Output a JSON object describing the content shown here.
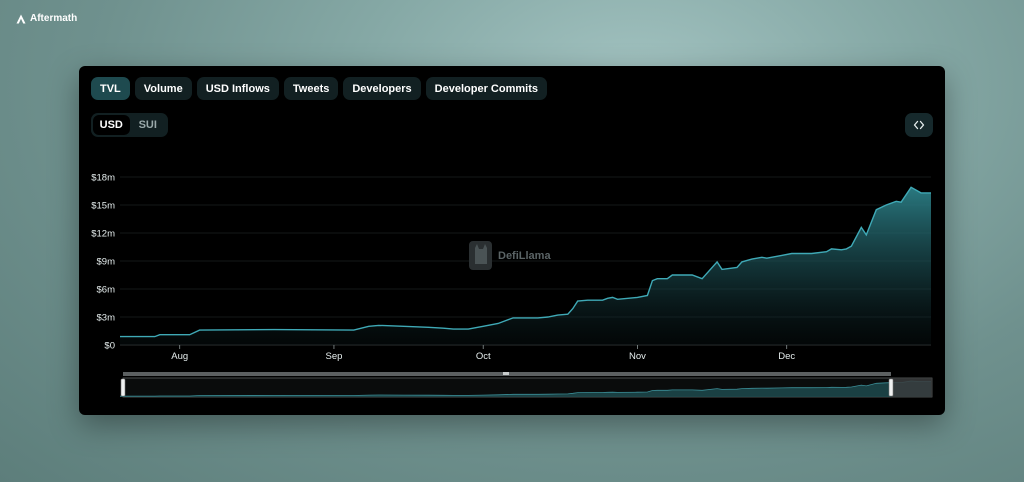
{
  "brand": {
    "name": "Aftermath",
    "logo_icon": "aftermath-logo-icon"
  },
  "tabs": [
    {
      "label": "TVL",
      "active": true
    },
    {
      "label": "Volume",
      "active": false
    },
    {
      "label": "USD Inflows",
      "active": false
    },
    {
      "label": "Tweets",
      "active": false
    },
    {
      "label": "Developers",
      "active": false
    },
    {
      "label": "Developer Commits",
      "active": false
    }
  ],
  "currency_toggle": {
    "options": [
      {
        "label": "USD",
        "active": true
      },
      {
        "label": "SUI",
        "active": false
      }
    ]
  },
  "embed_button": {
    "icon": "code-brackets-icon"
  },
  "watermark": {
    "text": "DefiLlama",
    "icon": "llama-icon"
  },
  "colors": {
    "line": "#3fa9b6",
    "fill_top": "#2c7f87",
    "tab_active": "#1e4a4f",
    "tab_bg": "#122022"
  },
  "chart_data": {
    "type": "area",
    "title": "",
    "xlabel": "",
    "ylabel": "",
    "grid": true,
    "legend": "none",
    "ylim": [
      0,
      18000000
    ],
    "yticks": [
      {
        "value": 0,
        "label": "$0"
      },
      {
        "value": 3000000,
        "label": "$3m"
      },
      {
        "value": 6000000,
        "label": "$6m"
      },
      {
        "value": 9000000,
        "label": "$9m"
      },
      {
        "value": 12000000,
        "label": "$12m"
      },
      {
        "value": 15000000,
        "label": "$15m"
      },
      {
        "value": 18000000,
        "label": "$18m"
      }
    ],
    "xrange": [
      "2023-07-20",
      "2023-12-30"
    ],
    "xticks": [
      {
        "date": "2023-08-01",
        "label": "Aug"
      },
      {
        "date": "2023-09-01",
        "label": "Sep"
      },
      {
        "date": "2023-10-01",
        "label": "Oct"
      },
      {
        "date": "2023-11-01",
        "label": "Nov"
      },
      {
        "date": "2023-12-01",
        "label": "Dec"
      }
    ],
    "series": [
      {
        "x": [
          "2023-07-20",
          "2023-07-27",
          "2023-07-28",
          "2023-08-03",
          "2023-08-05",
          "2023-08-20",
          "2023-09-05",
          "2023-09-08",
          "2023-09-10",
          "2023-09-15",
          "2023-09-20",
          "2023-09-23",
          "2023-09-25",
          "2023-09-28",
          "2023-10-01",
          "2023-10-04",
          "2023-10-07",
          "2023-10-12",
          "2023-10-14",
          "2023-10-16",
          "2023-10-18",
          "2023-10-19",
          "2023-10-20",
          "2023-10-22",
          "2023-10-24",
          "2023-10-25",
          "2023-10-26",
          "2023-10-27",
          "2023-10-28",
          "2023-11-01",
          "2023-11-03",
          "2023-11-04",
          "2023-11-05",
          "2023-11-07",
          "2023-11-08",
          "2023-11-09",
          "2023-11-10",
          "2023-11-12",
          "2023-11-14",
          "2023-11-17",
          "2023-11-18",
          "2023-11-21",
          "2023-11-22",
          "2023-11-24",
          "2023-11-26",
          "2023-11-27",
          "2023-11-30",
          "2023-12-02",
          "2023-12-04",
          "2023-12-06",
          "2023-12-09",
          "2023-12-10",
          "2023-12-12",
          "2023-12-13",
          "2023-12-14",
          "2023-12-16",
          "2023-12-17",
          "2023-12-19",
          "2023-12-21",
          "2023-12-23",
          "2023-12-24",
          "2023-12-26",
          "2023-12-28",
          "2023-12-30"
        ],
        "values": [
          900000,
          900000,
          1100000,
          1100000,
          1600000,
          1650000,
          1600000,
          2000000,
          2100000,
          2000000,
          1900000,
          1800000,
          1700000,
          1700000,
          2000000,
          2300000,
          2900000,
          2900000,
          3000000,
          3200000,
          3300000,
          3900000,
          4700000,
          4800000,
          4800000,
          4800000,
          5000000,
          5100000,
          4900000,
          5100000,
          5300000,
          6900000,
          7100000,
          7100000,
          7500000,
          7500000,
          7500000,
          7500000,
          7100000,
          8900000,
          8100000,
          8300000,
          8900000,
          9200000,
          9400000,
          9300000,
          9600000,
          9800000,
          9800000,
          9800000,
          10000000,
          10300000,
          10200000,
          10300000,
          10600000,
          12600000,
          11800000,
          14500000,
          15000000,
          15400000,
          15300000,
          16900000,
          16300000,
          16300000
        ]
      }
    ]
  }
}
